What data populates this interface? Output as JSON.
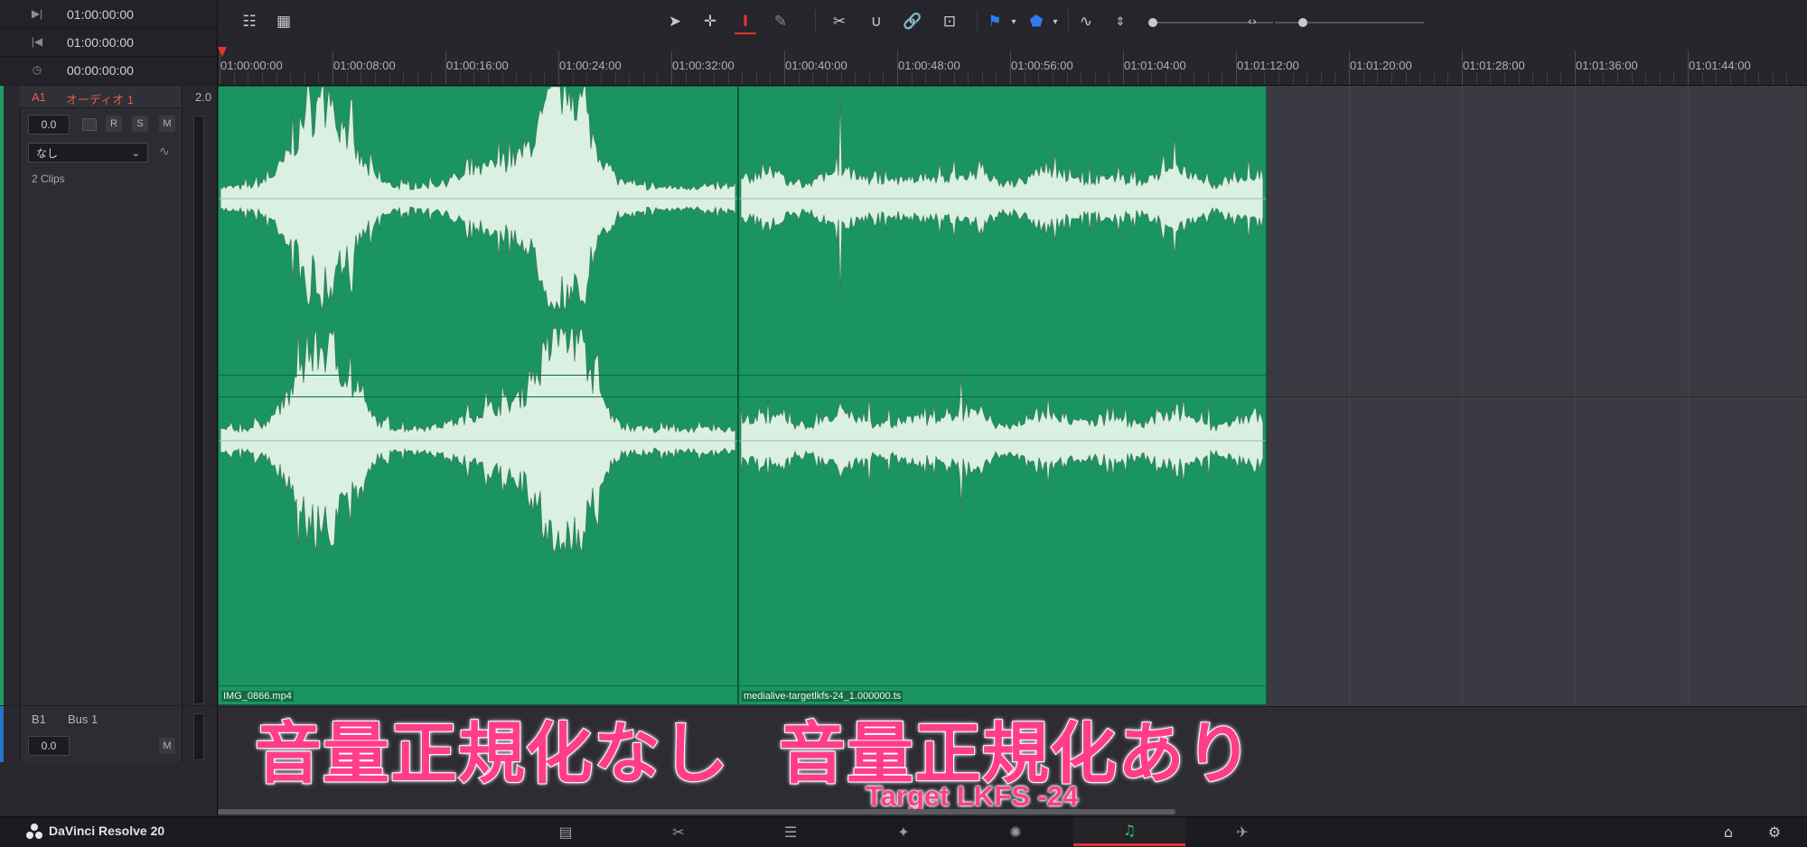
{
  "timecodes": [
    {
      "icon": "to-out-icon",
      "glyph": "▶|",
      "value": "01:00:00:00"
    },
    {
      "icon": "to-in-icon",
      "glyph": "|◀",
      "value": "01:00:00:00"
    },
    {
      "icon": "duration-clock-icon",
      "glyph": "◷",
      "value": "00:00:00:00"
    }
  ],
  "toolbar": {
    "left_icons": [
      {
        "name": "timeline-view-options-icon",
        "glyph": "☷"
      },
      {
        "name": "grid-view-icon",
        "glyph": "▦"
      }
    ],
    "tools": [
      {
        "name": "selection-tool-icon",
        "glyph": "➤"
      },
      {
        "name": "trim-tool-icon",
        "glyph": "✛"
      },
      {
        "name": "range-selection-tool-icon",
        "glyph": "I"
      },
      {
        "name": "pencil-tool-icon",
        "glyph": "✎"
      },
      {
        "name": "razor-tool-icon",
        "glyph": "✂"
      },
      {
        "name": "snapping-icon",
        "glyph": "∪"
      },
      {
        "name": "linked-selection-icon",
        "glyph": "🔗"
      },
      {
        "name": "automation-icon",
        "glyph": "⊡"
      },
      {
        "name": "flag-icon",
        "glyph": "⚑"
      },
      {
        "name": "marker-icon",
        "glyph": "⬟"
      },
      {
        "name": "waveform-zoom-icon",
        "glyph": "∿"
      },
      {
        "name": "vertical-zoom-icon",
        "glyph": "⇕"
      },
      {
        "name": "horizontal-zoom-icon",
        "glyph": "‹›"
      }
    ]
  },
  "ruler": {
    "labels": [
      "01:00:00:00",
      "01:00:08:00",
      "01:00:16:00",
      "01:00:24:00",
      "01:00:32:00",
      "01:00:40:00",
      "01:00:48:00",
      "01:00:56:00",
      "01:01:04:00",
      "01:01:12:00",
      "01:01:20:00",
      "01:01:28:00",
      "01:01:36:00",
      "01:01:44:00"
    ]
  },
  "track_a1": {
    "id": "A1",
    "name": "オーディオ 1",
    "format": "2.0",
    "volume": "0.0",
    "buttons": [
      "R",
      "S",
      "M"
    ],
    "eq_preset": "なし",
    "clips_count": "2 Clips",
    "color": "#1a9560"
  },
  "track_b1": {
    "id": "B1",
    "name": "Bus 1",
    "volume": "0.0",
    "mute": "M",
    "color": "#2a74c8"
  },
  "clips": [
    {
      "name": "IMG_0866.mp4",
      "profile": "unnormalized"
    },
    {
      "name": "medialive-targetlkfs-24_1.000000.ts",
      "profile": "normalized"
    }
  ],
  "overlay": {
    "left_title": "音量正規化なし",
    "right_title": "音量正規化あり",
    "subtitle": "Target LKFS -24",
    "color": "#ff3d8b"
  },
  "bottom_bar": {
    "app_name": "DaVinci Resolve 20",
    "pages": [
      {
        "name": "media-page-icon",
        "glyph": "▤",
        "active": false
      },
      {
        "name": "cut-page-icon",
        "glyph": "✂",
        "active": false
      },
      {
        "name": "edit-page-icon",
        "glyph": "☰",
        "active": false
      },
      {
        "name": "fusion-page-icon",
        "glyph": "✦",
        "active": false
      },
      {
        "name": "color-page-icon",
        "glyph": "✺",
        "active": false
      },
      {
        "name": "fairlight-page-icon",
        "glyph": "♫",
        "active": true
      },
      {
        "name": "deliver-page-icon",
        "glyph": "✈",
        "active": false
      }
    ],
    "home_icon": "⌂",
    "settings_icon": "⚙"
  }
}
